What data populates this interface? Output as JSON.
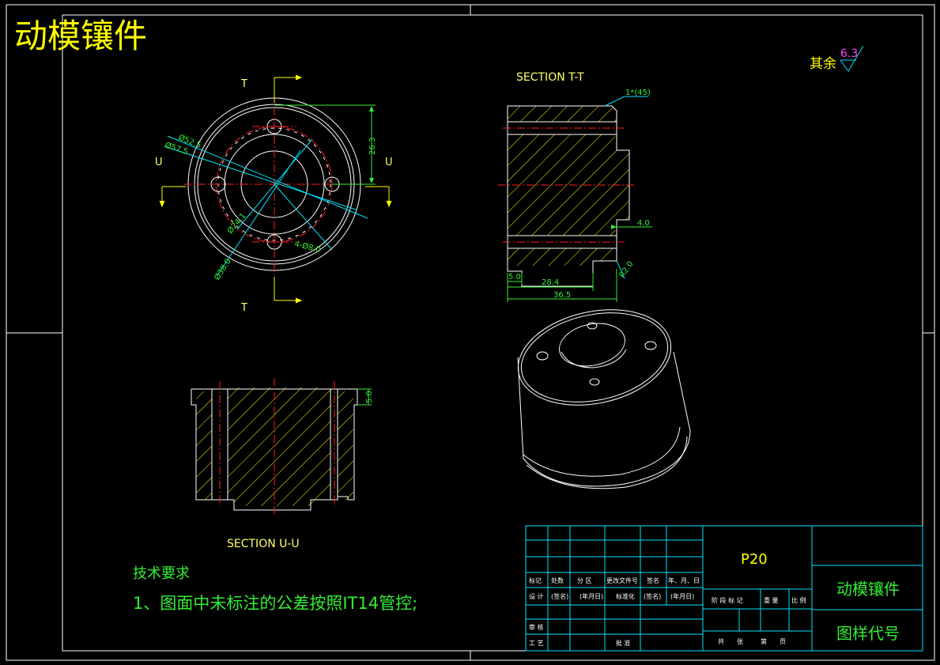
{
  "drawing": {
    "title": "动模镶件",
    "roughness_prefix": "其余",
    "roughness_value": "6.3",
    "section_tt": "SECTION T-T",
    "section_uu": "SECTION U-U",
    "cut_label_t": "T",
    "cut_label_u": "U",
    "tech_title": "技术要求",
    "tech_note": "1、图面中未标注的公差按照IT14管控;"
  },
  "dims": {
    "d52": "Ø52.5",
    "d57": "Ø57.5",
    "d24": "Ø24.1",
    "d38": "Ø38.0",
    "d8": "4-Ø8.0",
    "h26": "26.3",
    "chamfer": "1*(45)",
    "w4": "4.0",
    "r2": "R2.0",
    "w5": "5.0",
    "w28": "28.4",
    "w36": "36.5",
    "uu5": "5.0"
  },
  "titleblock": {
    "material": "P20",
    "part_name": "动模镶件",
    "drawing_code": "图样代号",
    "h_mark": "标记",
    "h_count": "处数",
    "h_zone": "分 区",
    "h_docno": "更改文件号",
    "h_sign": "签名",
    "h_date": "年、月、日",
    "h_design": "设 计",
    "h_signp": "(签名)",
    "h_datep": "(年月日)",
    "h_std": "标准化",
    "h_stage": "阶 段 标 记",
    "h_weight": "重 量",
    "h_scale": "比 例",
    "h_check": "审 核",
    "h_craft": "工 艺",
    "h_approve": "批 准",
    "h_total": "共　　张",
    "h_page": "第　　页"
  }
}
